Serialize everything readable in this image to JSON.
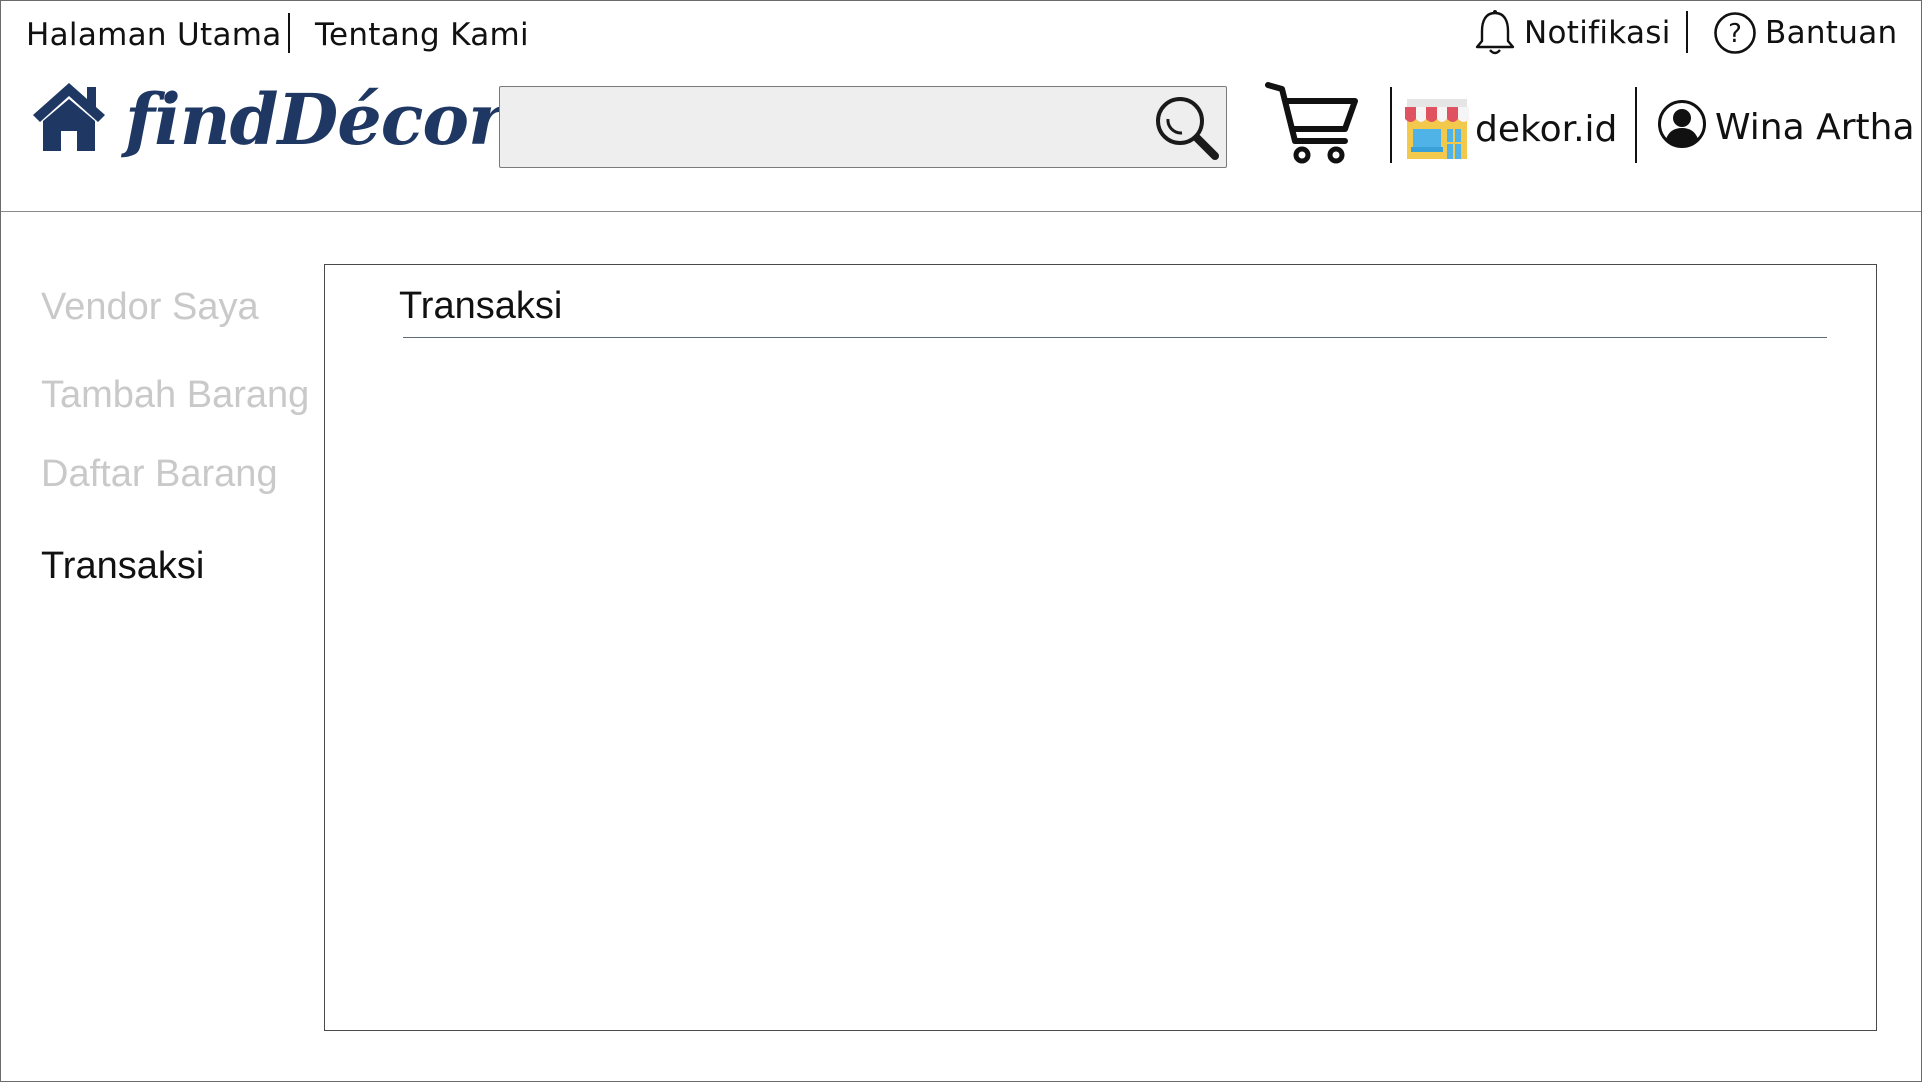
{
  "topnav": {
    "home_link": "Halaman Utama",
    "about_link": "Tentang Kami",
    "notifications_label": "Notifikasi",
    "help_label": "Bantuan"
  },
  "brand": {
    "logo_text": "findDécor",
    "logo_icon": "house-icon",
    "color": "#1f3763"
  },
  "search": {
    "value": "",
    "placeholder": "",
    "icon": "search-icon"
  },
  "header_actions": {
    "cart_icon": "cart-icon",
    "store_icon": "store-icon",
    "store_name": "dekor.id",
    "user_icon": "user-avatar-icon",
    "user_name": "Wina Artha"
  },
  "sidebar": {
    "items": [
      {
        "label": "Vendor Saya",
        "active": false
      },
      {
        "label": "Tambah Barang",
        "active": false
      },
      {
        "label": "Daftar Barang",
        "active": false
      },
      {
        "label": "Transaksi",
        "active": true
      }
    ],
    "inactive_color": "#c9c9c9",
    "active_color": "#111111"
  },
  "main": {
    "title": "Transaksi"
  }
}
